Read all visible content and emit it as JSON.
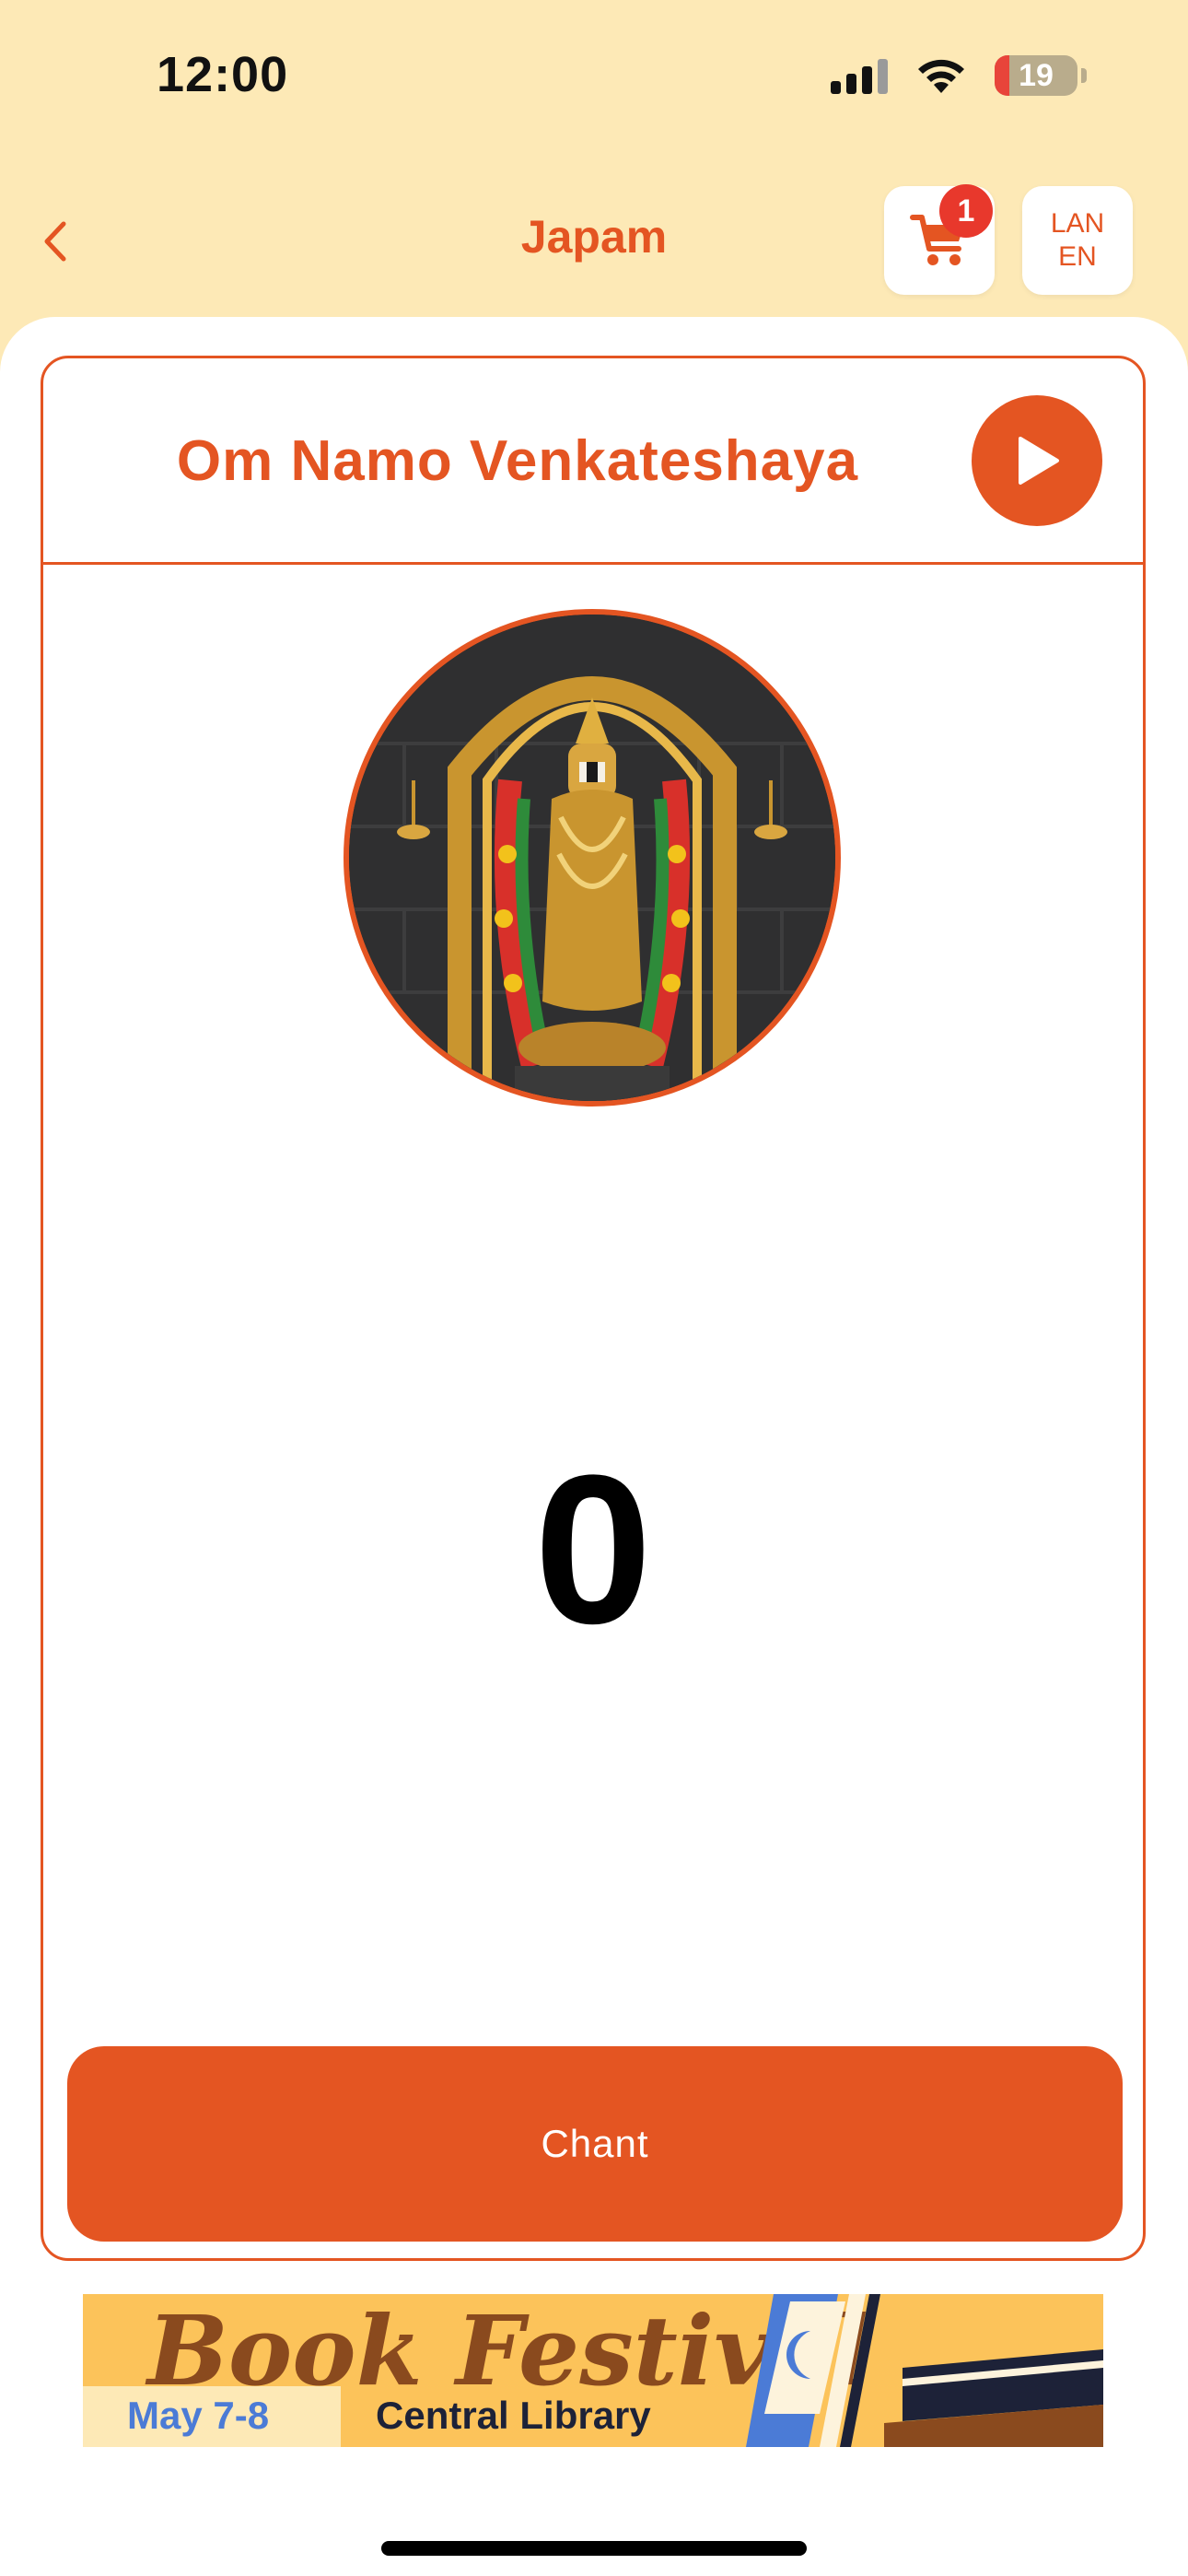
{
  "status_bar": {
    "time": "12:00",
    "battery": "19",
    "icons": [
      "signal-icon",
      "wifi-icon",
      "battery-icon"
    ]
  },
  "nav": {
    "title": "Japam",
    "back_icon": "chevron-left-icon",
    "cart_icon": "cart-icon",
    "cart_badge": "1",
    "lang_top": "LAN",
    "lang_bottom": "EN"
  },
  "card": {
    "mantra": "Om Namo Venkateshaya",
    "play_icon": "play-icon",
    "deity_image": "venkateswara-deity-image",
    "count": "0",
    "chant_label": "Chant"
  },
  "banner": {
    "title": "Book Festival",
    "date": "May 7-8",
    "venue": "Central Library"
  },
  "colors": {
    "accent": "#e45522",
    "background": "#fde9b6",
    "badge": "#e8382c"
  }
}
